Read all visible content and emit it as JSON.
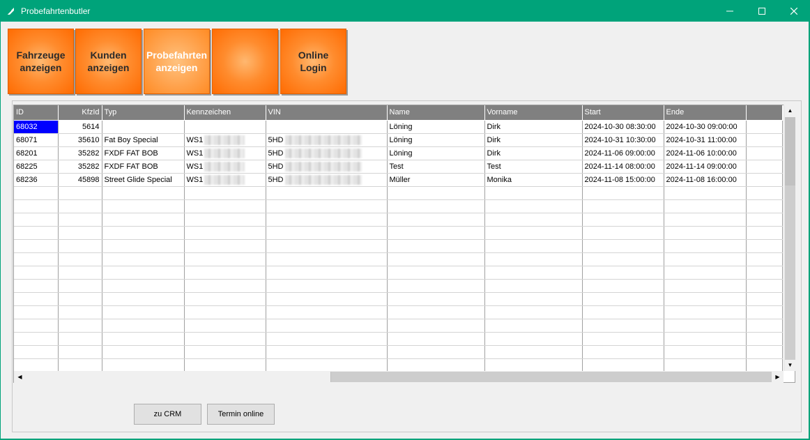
{
  "window": {
    "title": "Probefahrtenbutler"
  },
  "tiles": [
    {
      "label": "Fahrzeuge\nanzeigen",
      "active": false
    },
    {
      "label": "Kunden\nanzeigen",
      "active": false
    },
    {
      "label": "Probefahrten\nanzeigen",
      "active": true
    },
    {
      "label": "",
      "active": false
    },
    {
      "label": "Online\nLogin",
      "active": false
    }
  ],
  "table": {
    "columns": [
      "ID",
      "KfzId",
      "Typ",
      "Kennzeichen",
      "VIN",
      "Name",
      "Vorname",
      "Start",
      "Ende",
      ""
    ],
    "rows": [
      {
        "id": "68032",
        "kfzid": "5614",
        "typ": "",
        "kennzeichen": "",
        "vin": "",
        "name": "Löning",
        "vorname": "Dirk",
        "start": "2024-10-30 08:30:00",
        "ende": "2024-10-30 09:00:00"
      },
      {
        "id": "68071",
        "kfzid": "35610",
        "typ": "Fat Boy Special",
        "kennzeichen": "WS1",
        "vin": "5HD",
        "name": "Löning",
        "vorname": "Dirk",
        "start": "2024-10-31 10:30:00",
        "ende": "2024-10-31 11:00:00"
      },
      {
        "id": "68201",
        "kfzid": "35282",
        "typ": "FXDF FAT BOB",
        "kennzeichen": "WS1",
        "vin": "5HD",
        "name": "Löning",
        "vorname": "Dirk",
        "start": "2024-11-06 09:00:00",
        "ende": "2024-11-06 10:00:00"
      },
      {
        "id": "68225",
        "kfzid": "35282",
        "typ": "FXDF FAT BOB",
        "kennzeichen": "WS1",
        "vin": "5HD",
        "name": "Test",
        "vorname": "Test",
        "start": "2024-11-14 08:00:00",
        "ende": "2024-11-14 09:00:00"
      },
      {
        "id": "68236",
        "kfzid": "45898",
        "typ": "Street Glide Special",
        "kennzeichen": "WS1",
        "vin": "5HD",
        "name": "Müller",
        "vorname": "Monika",
        "start": "2024-11-08 15:00:00",
        "ende": "2024-11-08 16:00:00"
      }
    ],
    "empty_rows": 14
  },
  "buttons": {
    "crm": "zu CRM",
    "termin": "Termin online"
  },
  "colors": {
    "titlebar": "#00a37a",
    "tile": "#ff7a10",
    "header": "#808080",
    "selection": "#0000ff"
  }
}
